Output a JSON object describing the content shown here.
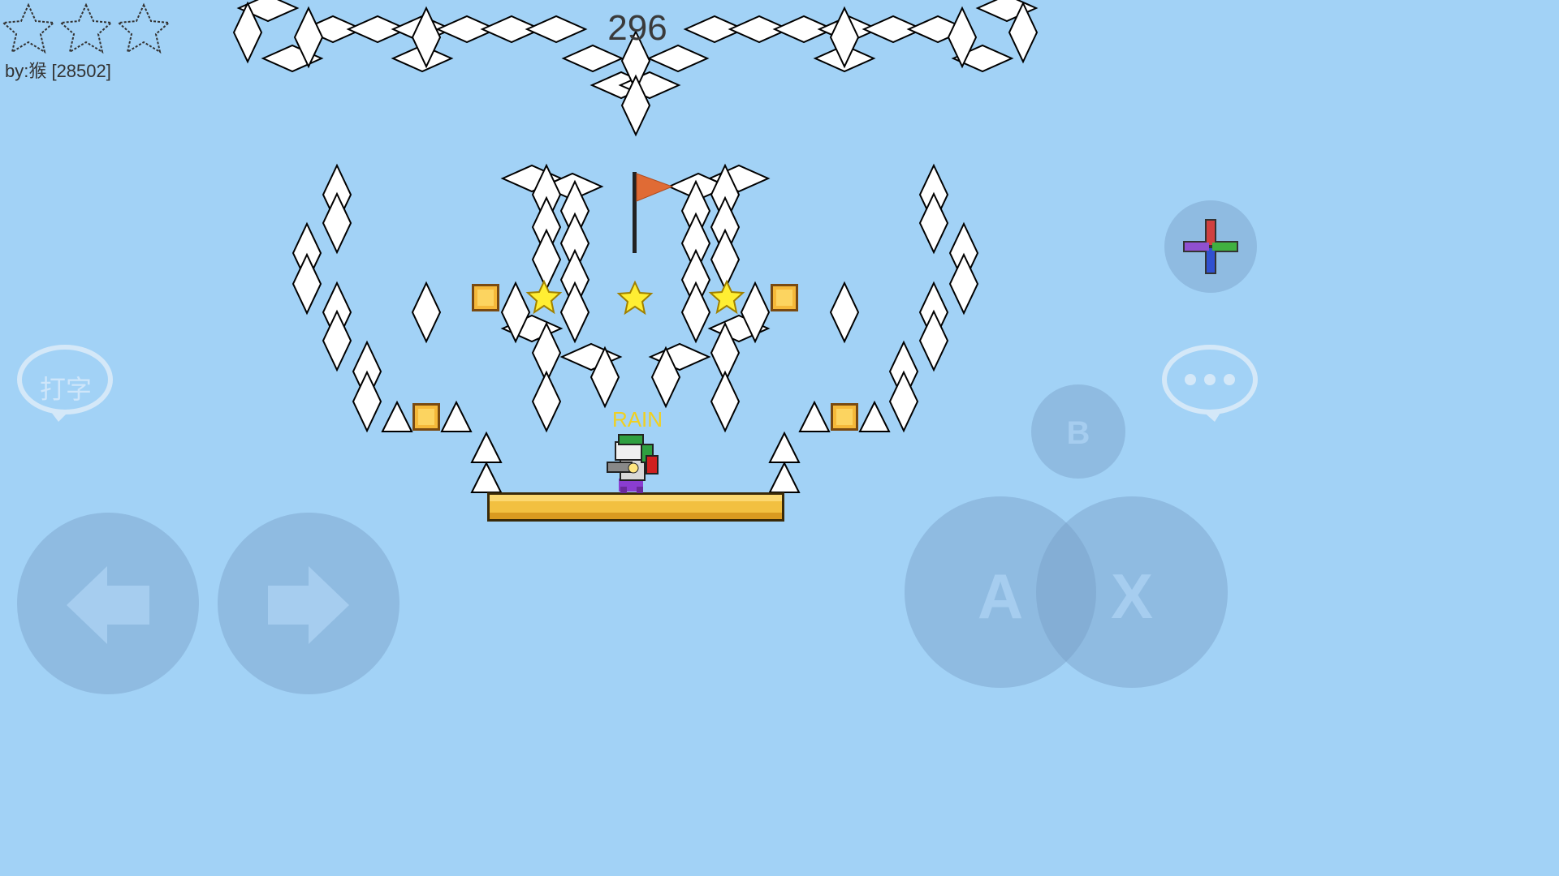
{
  "hud": {
    "stars_collected": 0,
    "stars_total": 3,
    "author": "by:猴 [28502]",
    "timer": "296"
  },
  "player": {
    "name": "RAIN"
  },
  "controls": {
    "chat_left_label": "打字",
    "b_label": "B",
    "a_label": "A",
    "x_label": "X"
  },
  "colors": {
    "sky": "#a2d2f6",
    "flag": "#e06b35",
    "platform": "#f2c040",
    "star": "#ffee33"
  }
}
